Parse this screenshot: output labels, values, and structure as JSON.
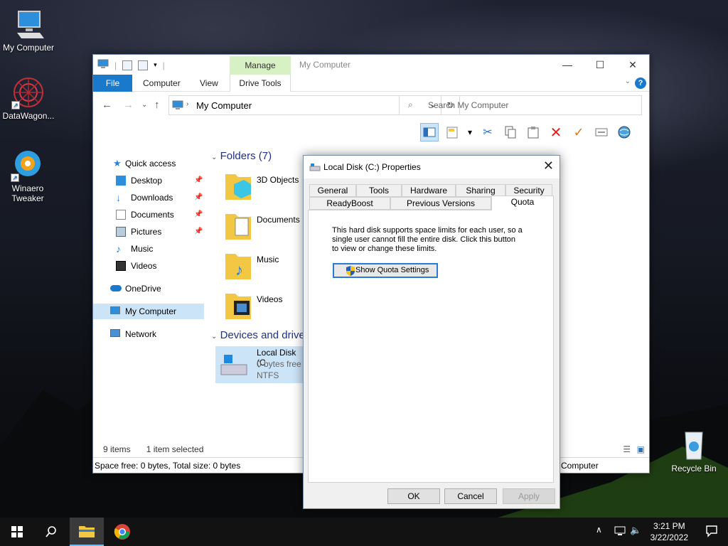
{
  "desktop": {
    "icons": [
      {
        "label": "My Computer"
      },
      {
        "label": "DataWagon..."
      },
      {
        "label": "Winaero Tweaker"
      },
      {
        "label": "Recycle Bin"
      }
    ]
  },
  "explorer": {
    "title": "My Computer",
    "manage_tab": "Manage",
    "tabs": {
      "file": "File",
      "computer": "Computer",
      "view": "View",
      "drive_tools": "Drive Tools"
    },
    "address": "My Computer",
    "search_placeholder": "Search My Computer",
    "nav": {
      "quick_access": "Quick access",
      "desktop": "Desktop",
      "downloads": "Downloads",
      "documents": "Documents",
      "pictures": "Pictures",
      "music": "Music",
      "videos": "Videos",
      "onedrive": "OneDrive",
      "my_computer": "My Computer",
      "network": "Network"
    },
    "folders_header": "Folders (7)",
    "folders": [
      "3D Objects",
      "Documents",
      "Music",
      "Videos"
    ],
    "devices_header": "Devices and drive",
    "drive": {
      "name": "Local Disk (C",
      "free": "0 bytes free",
      "fs": "NTFS"
    },
    "status_items": "9 items",
    "status_selected": "1 item selected",
    "status_space": "Space free: 0 bytes, Total size: 0 bytes",
    "status_right": "Computer"
  },
  "dialog": {
    "title": "Local Disk (C:) Properties",
    "tabs_back": [
      "General",
      "Tools",
      "Hardware",
      "Sharing",
      "Security"
    ],
    "tabs_front": [
      "ReadyBoost",
      "Previous Versions",
      "Quota"
    ],
    "active_tab": "Quota",
    "quota_text": "This hard disk supports space limits for each user, so a single user cannot fill the entire disk. Click this button to view or change these limits.",
    "quota_button": "Show Quota Settings",
    "ok": "OK",
    "cancel": "Cancel",
    "apply": "Apply"
  },
  "taskbar": {
    "time": "3:21 PM",
    "date": "3/22/2022"
  },
  "colors": {
    "accent": "#1979ca",
    "manage_tab": "#d7f0c4",
    "selection": "#cce4f7"
  }
}
